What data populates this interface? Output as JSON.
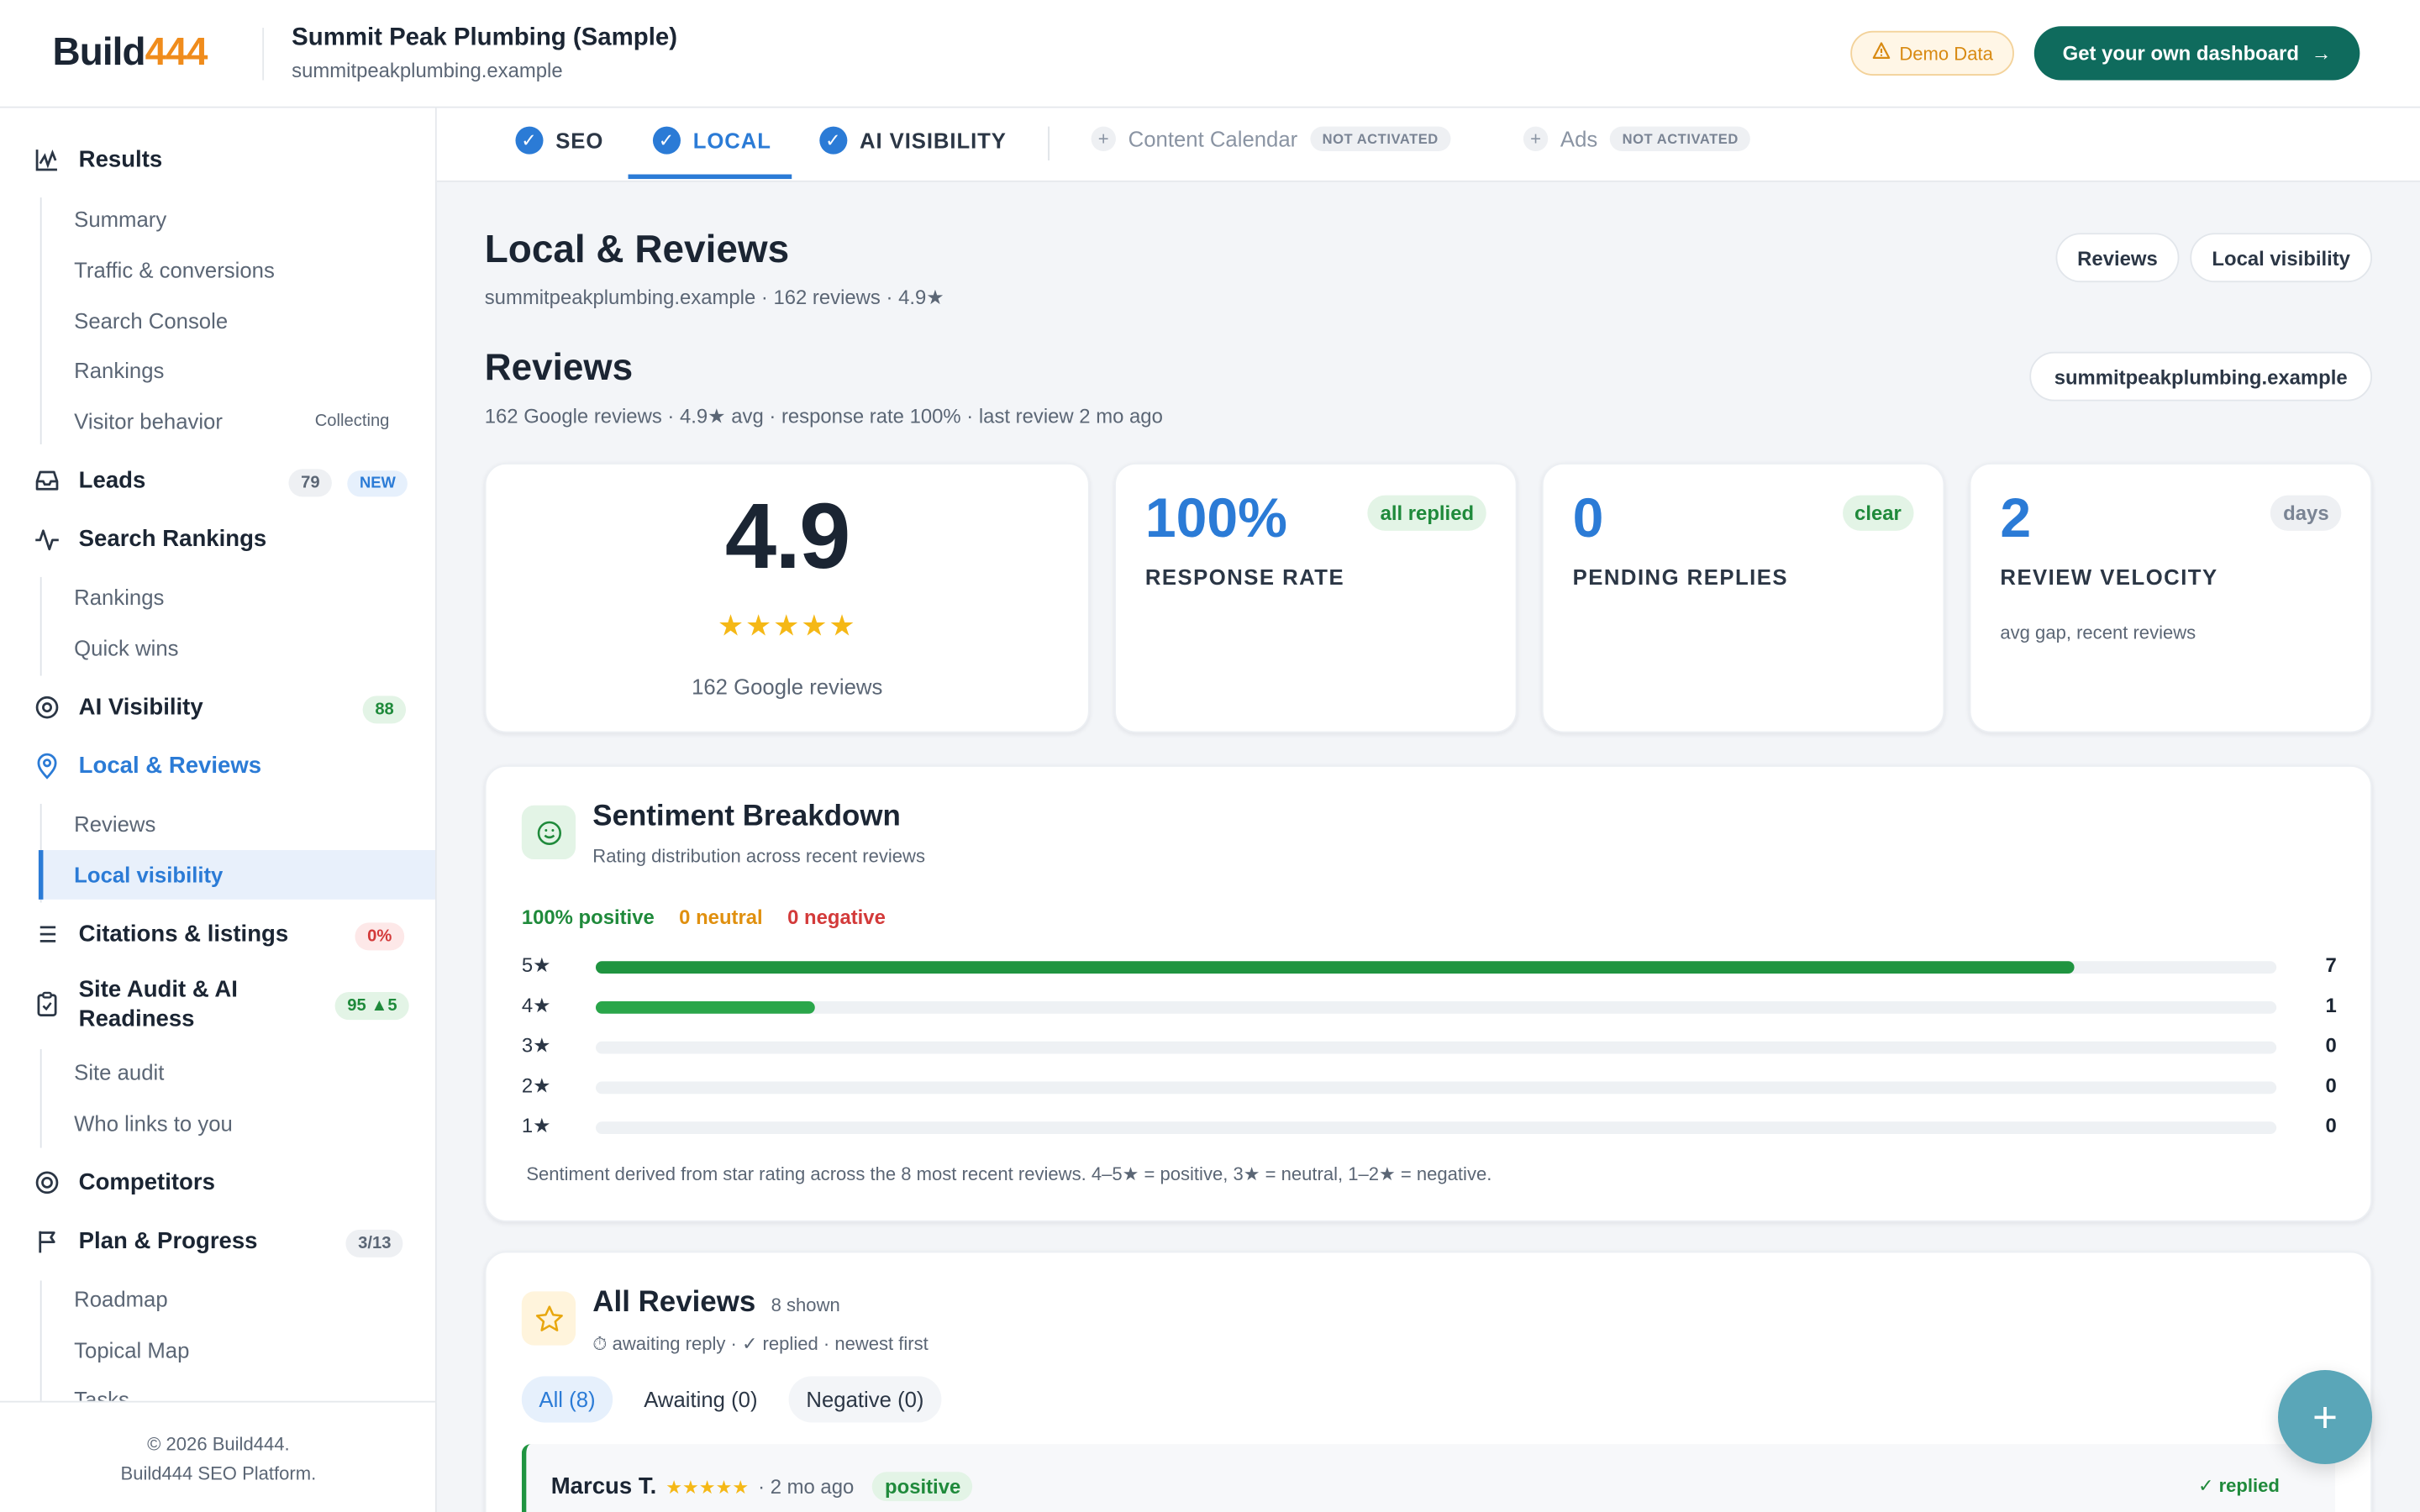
{
  "header": {
    "logo_text": "Build",
    "logo_num": "444",
    "site_title": "Summit Peak Plumbing (Sample)",
    "site_url": "summitpeakplumbing.example",
    "demo_badge": "Demo Data",
    "cta_label": "Get your own dashboard"
  },
  "sidebar": {
    "results": "Results",
    "results_items": [
      "Summary",
      "Traffic & conversions",
      "Search Console",
      "Rankings",
      "Visitor behavior"
    ],
    "collecting": "Collecting",
    "leads": "Leads",
    "leads_count": "79",
    "leads_new": "NEW",
    "search_rankings": "Search Rankings",
    "search_items": [
      "Rankings",
      "Quick wins"
    ],
    "ai_visibility": "AI Visibility",
    "ai_score": "88",
    "local_reviews": "Local & Reviews",
    "local_items": [
      "Reviews",
      "Local visibility"
    ],
    "citations": "Citations & listings",
    "citations_pct": "0%",
    "site_audit_1": "Site Audit & AI",
    "site_audit_2": "Readiness",
    "site_audit_score": "95 ▲5",
    "audit_items": [
      "Site audit",
      "Who links to you"
    ],
    "competitors": "Competitors",
    "plan": "Plan & Progress",
    "plan_count": "3/13",
    "plan_items": [
      "Roadmap",
      "Topical Map",
      "Tasks"
    ],
    "footer_1": "© 2026 Build444.",
    "footer_2": "Build444 SEO Platform."
  },
  "tabs": {
    "seo": "SEO",
    "local": "LOCAL",
    "ai": "AI VISIBILITY",
    "content": "Content Calendar",
    "ads": "Ads",
    "not_activated": "NOT ACTIVATED"
  },
  "page": {
    "title": "Local & Reviews",
    "subtitle": "summitpeakplumbing.example · 162 reviews · 4.9★",
    "chip_reviews": "Reviews",
    "chip_local": "Local visibility",
    "reviews_title": "Reviews",
    "reviews_sub": "162 Google reviews · 4.9★ avg · response rate 100% · last review 2 mo ago",
    "domain_chip": "summitpeakplumbing.example"
  },
  "stats": {
    "rating": "4.9",
    "rating_stars": "★★★★★",
    "rating_count": "162 Google reviews",
    "response_rate": "100%",
    "response_label": "RESPONSE RATE",
    "response_badge": "all replied",
    "pending": "0",
    "pending_label": "PENDING REPLIES",
    "pending_badge": "clear",
    "velocity": "2",
    "velocity_label": "REVIEW VELOCITY",
    "velocity_badge": "days",
    "velocity_note": "avg gap, recent reviews"
  },
  "sentiment": {
    "title": "Sentiment Breakdown",
    "subtitle": "Rating distribution across recent reviews",
    "positive": "100% positive",
    "neutral": "0 neutral",
    "negative": "0 negative",
    "rows": [
      {
        "label": "5★",
        "count": "7",
        "fraction": 0.88
      },
      {
        "label": "4★",
        "count": "1",
        "fraction": 0.13
      },
      {
        "label": "3★",
        "count": "0",
        "fraction": 0
      },
      {
        "label": "2★",
        "count": "0",
        "fraction": 0
      },
      {
        "label": "1★",
        "count": "0",
        "fraction": 0
      }
    ],
    "note": "Sentiment derived from star rating across the 8 most recent reviews. 4–5★ = positive, 3★ = neutral, 1–2★ = negative."
  },
  "all_reviews": {
    "title": "All Reviews",
    "shown": "8 shown",
    "legend": "⏱ awaiting reply · ✓ replied · newest first",
    "filter_all": "All (8)",
    "filter_awaiting": "Awaiting (0)",
    "filter_negative": "Negative (0)",
    "first": {
      "name": "Marcus T.",
      "stars": "★★★★★",
      "ago": "· 2 mo ago",
      "tag": "positive",
      "status": "✓ replied"
    }
  },
  "colors": {
    "accent": "#2b7bd6",
    "brand_green": "#0f6b5d",
    "positive": "#1f9440",
    "warning": "#f08c1c",
    "negative": "#d33a3a"
  }
}
